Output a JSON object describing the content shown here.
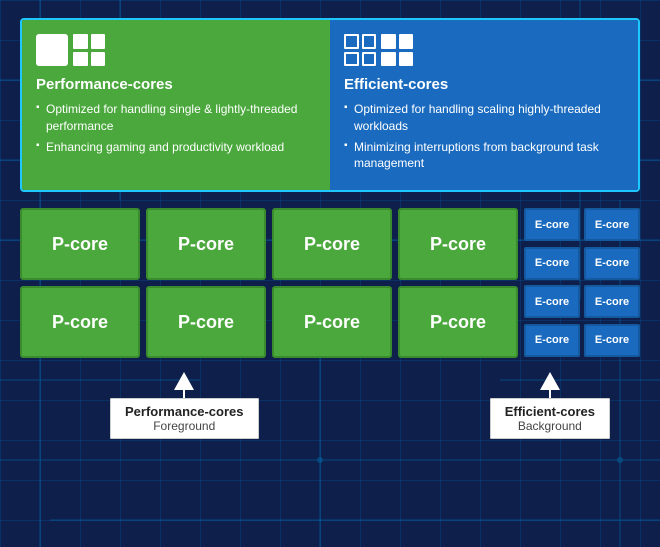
{
  "background": {
    "color": "#0d1f4a"
  },
  "top_panel": {
    "border_color": "#1ec8ff",
    "left": {
      "bg_color": "#4aa83c",
      "title": "Performance-cores",
      "bullets": [
        "Optimized for handling single & lightly-threaded performance",
        "Enhancing gaming and productivity workload"
      ]
    },
    "right": {
      "bg_color": "#1a6bbf",
      "title": "Efficient-cores",
      "bullets": [
        "Optimized for handling scaling highly-threaded workloads",
        "Minimizing interruptions from background task management"
      ]
    }
  },
  "core_grid": {
    "p_cores": [
      "P-core",
      "P-core",
      "P-core",
      "P-core",
      "P-core",
      "P-core",
      "P-core",
      "P-core"
    ],
    "e_cores": [
      "E-core",
      "E-core",
      "E-core",
      "E-core",
      "E-core",
      "E-core",
      "E-core",
      "E-core"
    ]
  },
  "arrows": {
    "left": {
      "title": "Performance-cores",
      "subtitle": "Foreground"
    },
    "right": {
      "title": "Efficient-cores",
      "subtitle": "Background"
    }
  }
}
